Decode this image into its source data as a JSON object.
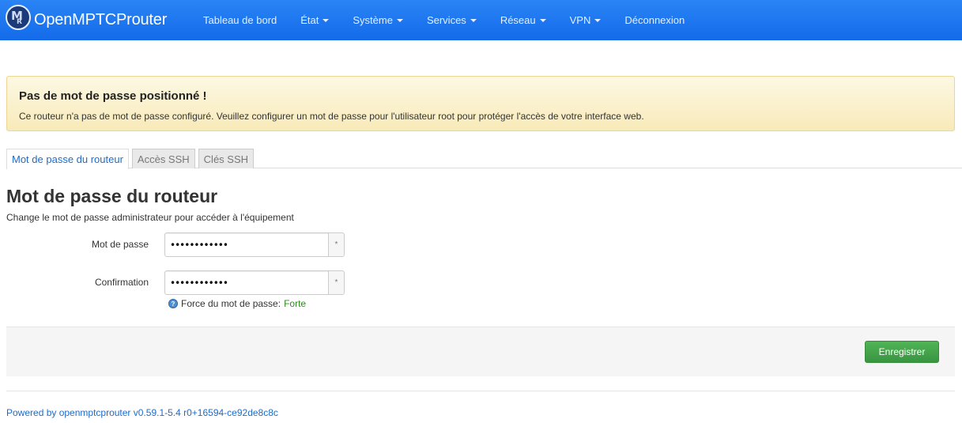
{
  "brand": {
    "title": "OpenMPTCProuter",
    "logo_letter_main": "M",
    "logo_letter_sub": "R"
  },
  "nav": {
    "items": [
      {
        "label": "Tableau de bord",
        "dropdown": false
      },
      {
        "label": "État",
        "dropdown": true
      },
      {
        "label": "Système",
        "dropdown": true
      },
      {
        "label": "Services",
        "dropdown": true
      },
      {
        "label": "Réseau",
        "dropdown": true
      },
      {
        "label": "VPN",
        "dropdown": true
      },
      {
        "label": "Déconnexion",
        "dropdown": false
      }
    ]
  },
  "alert": {
    "title": "Pas de mot de passe positionné !",
    "text": "Ce routeur n'a pas de mot de passe configuré. Veuillez configurer un mot de passe pour l'utilisateur root pour protéger l'accès de votre interface web."
  },
  "tabs": [
    {
      "label": "Mot de passe du routeur",
      "active": true
    },
    {
      "label": "Accès SSH",
      "active": false
    },
    {
      "label": "Clés SSH",
      "active": false
    }
  ],
  "section": {
    "title": "Mot de passe du routeur",
    "description": "Change le mot de passe administrateur pour accéder à l'équipement"
  },
  "form": {
    "password": {
      "label": "Mot de passe",
      "value": "••••••••••••",
      "reveal_symbol": "*"
    },
    "confirmation": {
      "label": "Confirmation",
      "value": "••••••••••••",
      "reveal_symbol": "*"
    },
    "strength": {
      "label": "Force du mot de passe:",
      "value": "Forte",
      "help_symbol": "?"
    }
  },
  "actions": {
    "save_label": "Enregistrer"
  },
  "footer": {
    "prefix": "Powered by ",
    "link": "openmptcprouter v0.59.1-5.4 r0+16594-ce92de8c8c"
  },
  "colors": {
    "navbar": "#1a76f0",
    "alert_bg": "#fcf3d1",
    "save_button": "#43a34a",
    "link": "#1f6bc9",
    "strength_good": "#2f8a1f"
  }
}
